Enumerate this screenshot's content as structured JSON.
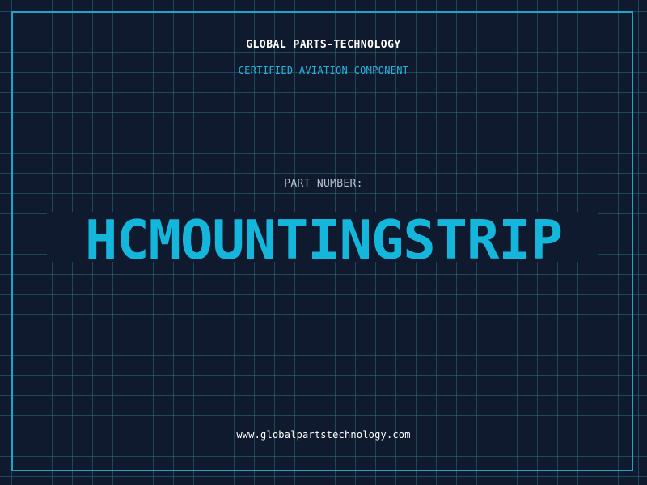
{
  "header": {
    "company": "GLOBAL PARTS-TECHNOLOGY",
    "subtitle": "CERTIFIED AVIATION COMPONENT"
  },
  "part": {
    "label": "PART NUMBER:",
    "number": "HCMOUNTINGSTRIP"
  },
  "footer": {
    "website": "www.globalpartstechnology.com"
  },
  "colors": {
    "background": "#101a2e",
    "grid": "#266e7d",
    "accent": "#14b6dc",
    "text": "#ffffff",
    "muted": "#b8bfcc"
  }
}
